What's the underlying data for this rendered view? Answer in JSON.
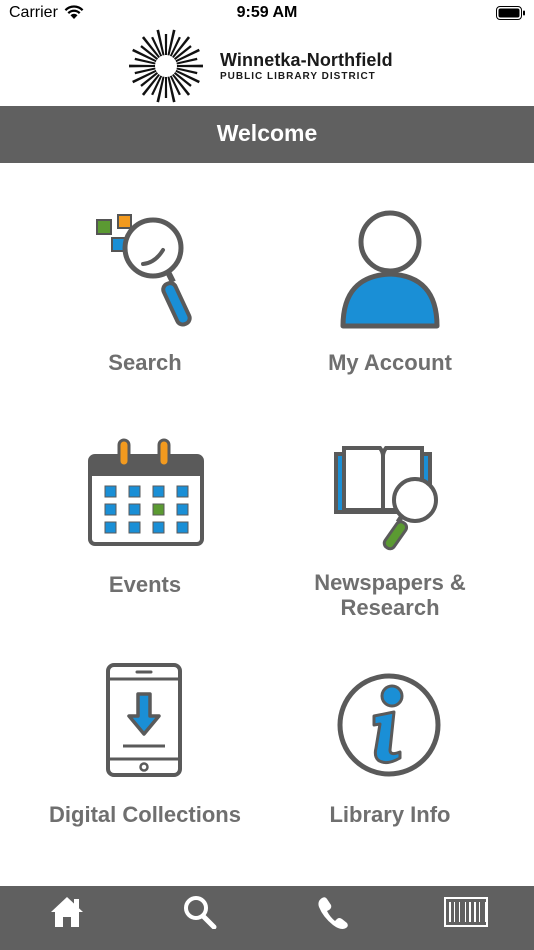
{
  "status_bar": {
    "carrier": "Carrier",
    "time": "9:59 AM"
  },
  "logo": {
    "line1": "Winnetka-Northfield",
    "line2": "PUBLIC LIBRARY DISTRICT"
  },
  "header": {
    "title": "Welcome"
  },
  "tiles": [
    {
      "label": "Search",
      "icon": "search-magnifier-icon"
    },
    {
      "label": "My Account",
      "icon": "user-account-icon"
    },
    {
      "label": "Events",
      "icon": "calendar-icon"
    },
    {
      "label": "Newspapers &",
      "label2": "Research",
      "icon": "book-magnifier-icon"
    },
    {
      "label": "Digital Collections",
      "icon": "tablet-download-icon"
    },
    {
      "label": "Library Info",
      "icon": "info-icon"
    }
  ],
  "tab_bar": [
    {
      "icon": "home-icon"
    },
    {
      "icon": "search-icon"
    },
    {
      "icon": "phone-icon"
    },
    {
      "icon": "barcode-icon"
    }
  ],
  "colors": {
    "bar_gray": "#606060",
    "icon_gray": "#5a5a5a",
    "accent_blue": "#1a8fd6",
    "accent_orange": "#f29a1f",
    "accent_green": "#5b9a32"
  }
}
